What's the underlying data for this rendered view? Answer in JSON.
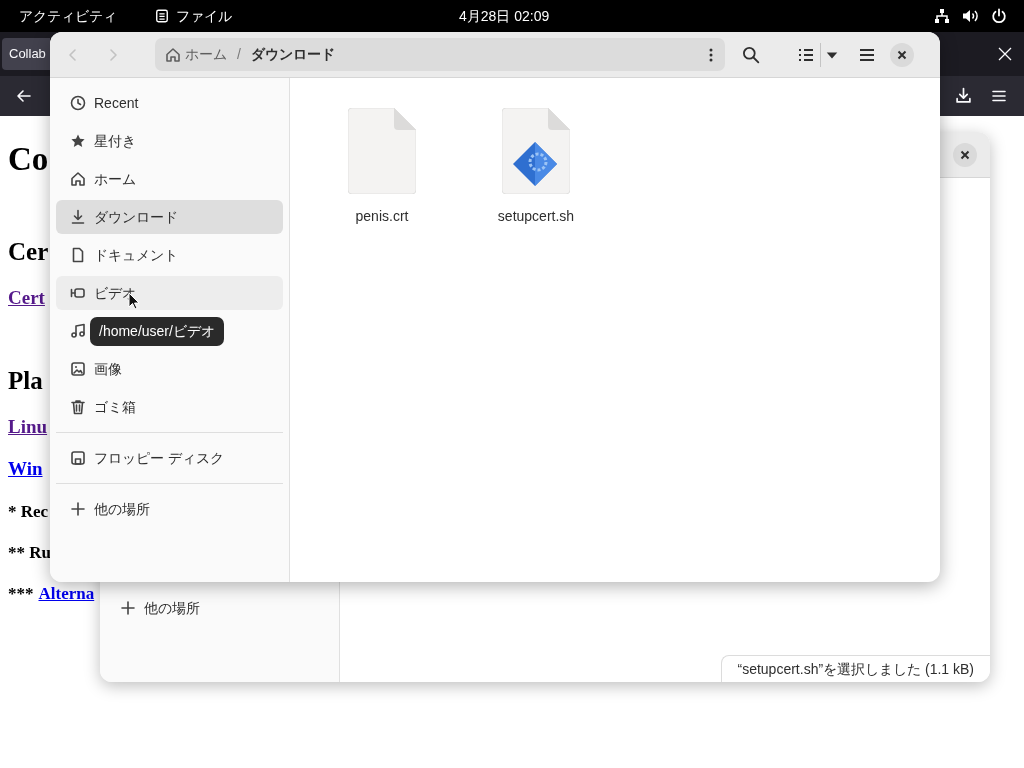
{
  "top_bar": {
    "activities": "アクティビティ",
    "app_menu": "ファイル",
    "clock": "4月28日 02:09"
  },
  "browser": {
    "tab": "Collab",
    "page": [
      {
        "kind": "h1",
        "text": "Co"
      },
      {
        "kind": "h2",
        "text": "Cer"
      },
      {
        "kind": "link",
        "text": "Cert",
        "visited": true
      },
      {
        "kind": "h2",
        "text": "Pla"
      },
      {
        "kind": "link",
        "text": "Linu",
        "visited": true
      },
      {
        "kind": "link",
        "text": "Win",
        "visited": false
      },
      {
        "kind": "bold",
        "text": "* Rec"
      },
      {
        "kind": "bold",
        "text": "** Ru"
      },
      {
        "kind": "bold_link",
        "text": "***",
        "link": "Alterna",
        "visited": false
      }
    ]
  },
  "back_window": {
    "sidebar_item": "他の場所",
    "status": "“setupcert.sh”を選択しました (1.1 kB)"
  },
  "file_window": {
    "nav": [
      {
        "kind": "back",
        "disabled": true
      },
      {
        "kind": "forward",
        "disabled": true
      }
    ],
    "path": {
      "home": "ホーム",
      "separator": "/",
      "current": "ダウンロード"
    },
    "sidebar_sections": [
      {
        "items": [
          {
            "kind": "recent",
            "label": "Recent",
            "selected": false,
            "hovered": false
          },
          {
            "kind": "starred",
            "label": "星付き",
            "selected": false,
            "hovered": false
          },
          {
            "kind": "home",
            "label": "ホーム",
            "selected": false,
            "hovered": false
          },
          {
            "kind": "downloads",
            "label": "ダウンロード",
            "selected": true,
            "hovered": false
          },
          {
            "kind": "documents",
            "label": "ドキュメント",
            "selected": false,
            "hovered": false
          },
          {
            "kind": "videos",
            "label": "ビデオ",
            "selected": false,
            "hovered": true
          },
          {
            "kind": "music",
            "selected": false,
            "hovered": false
          },
          {
            "kind": "pictures",
            "label": "画像",
            "selected": false,
            "hovered": false
          },
          {
            "kind": "trash",
            "label": "ゴミ箱",
            "selected": false,
            "hovered": false
          }
        ]
      },
      {
        "items": [
          {
            "kind": "drive",
            "label": "フロッピー ディスク",
            "selected": false,
            "hovered": false
          }
        ]
      },
      {
        "items": [
          {
            "kind": "other",
            "label": "他の場所",
            "selected": false,
            "hovered": false
          }
        ]
      }
    ],
    "tooltip": "/home/user/ビデオ",
    "files": [
      {
        "kind": "blank",
        "name": "penis.crt"
      },
      {
        "kind": "script",
        "name": "setupcert.sh"
      }
    ]
  }
}
